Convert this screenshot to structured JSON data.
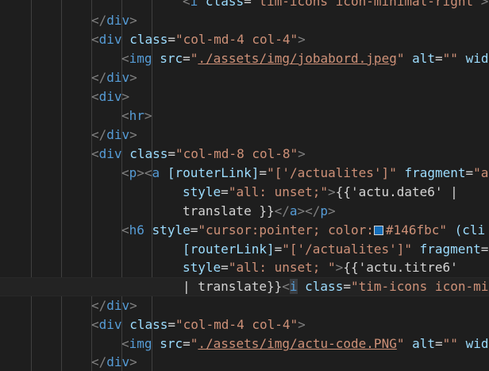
{
  "editor": {
    "swatch_color": "#146fbc",
    "lines": [
      {
        "segments": [
          {
            "cls": "t-p",
            "text": "<"
          },
          {
            "cls": "t-tag",
            "text": "i"
          },
          {
            "cls": "t-txt",
            "text": " "
          },
          {
            "cls": "t-attr",
            "text": "class"
          },
          {
            "cls": "t-txt",
            "text": "="
          },
          {
            "cls": "t-str",
            "text": "\"tim-icons icon-minimal-right\""
          },
          {
            "cls": "t-p",
            "text": ">"
          }
        ]
      },
      {
        "segments": [
          {
            "cls": "t-p",
            "text": "</"
          },
          {
            "cls": "t-tag",
            "text": "div"
          },
          {
            "cls": "t-p",
            "text": ">"
          }
        ]
      },
      {
        "segments": [
          {
            "cls": "t-p",
            "text": "<"
          },
          {
            "cls": "t-tag",
            "text": "div"
          },
          {
            "cls": "t-txt",
            "text": " "
          },
          {
            "cls": "t-attr",
            "text": "class"
          },
          {
            "cls": "t-txt",
            "text": "="
          },
          {
            "cls": "t-str",
            "text": "\"col-md-4 col-4\""
          },
          {
            "cls": "t-p",
            "text": ">"
          }
        ]
      },
      {
        "segments": [
          {
            "cls": "t-p",
            "text": "<"
          },
          {
            "cls": "t-tag",
            "text": "img"
          },
          {
            "cls": "t-txt",
            "text": " "
          },
          {
            "cls": "t-attr",
            "text": "src"
          },
          {
            "cls": "t-txt",
            "text": "="
          },
          {
            "cls": "t-str",
            "text": "\""
          },
          {
            "cls": "t-path",
            "text": "./assets/img/jobabord.jpeg"
          },
          {
            "cls": "t-str",
            "text": "\""
          },
          {
            "cls": "t-txt",
            "text": " "
          },
          {
            "cls": "t-attr",
            "text": "alt"
          },
          {
            "cls": "t-txt",
            "text": "="
          },
          {
            "cls": "t-str",
            "text": "\"\""
          },
          {
            "cls": "t-txt",
            "text": " "
          },
          {
            "cls": "t-attr",
            "text": "wid"
          }
        ]
      },
      {
        "segments": [
          {
            "cls": "t-p",
            "text": "</"
          },
          {
            "cls": "t-tag",
            "text": "div"
          },
          {
            "cls": "t-p",
            "text": ">"
          }
        ]
      },
      {
        "segments": [
          {
            "cls": "t-p",
            "text": "<"
          },
          {
            "cls": "t-tag",
            "text": "div"
          },
          {
            "cls": "t-p",
            "text": ">"
          }
        ]
      },
      {
        "segments": [
          {
            "cls": "t-p",
            "text": "<"
          },
          {
            "cls": "t-tag",
            "text": "hr"
          },
          {
            "cls": "t-p",
            "text": ">"
          }
        ]
      },
      {
        "segments": [
          {
            "cls": "t-p",
            "text": "</"
          },
          {
            "cls": "t-tag",
            "text": "div"
          },
          {
            "cls": "t-p",
            "text": ">"
          }
        ]
      },
      {
        "segments": [
          {
            "cls": "t-p",
            "text": "<"
          },
          {
            "cls": "t-tag",
            "text": "div"
          },
          {
            "cls": "t-txt",
            "text": " "
          },
          {
            "cls": "t-attr",
            "text": "class"
          },
          {
            "cls": "t-txt",
            "text": "="
          },
          {
            "cls": "t-str",
            "text": "\"col-md-8 col-8\""
          },
          {
            "cls": "t-p",
            "text": ">"
          }
        ]
      },
      {
        "segments": [
          {
            "cls": "t-p",
            "text": "<"
          },
          {
            "cls": "t-tag",
            "text": "p"
          },
          {
            "cls": "t-p",
            "text": "><"
          },
          {
            "cls": "t-tag",
            "text": "a"
          },
          {
            "cls": "t-txt",
            "text": " "
          },
          {
            "cls": "t-attr",
            "text": "[routerLink]"
          },
          {
            "cls": "t-txt",
            "text": "="
          },
          {
            "cls": "t-str",
            "text": "\"['/actualites']\""
          },
          {
            "cls": "t-txt",
            "text": " "
          },
          {
            "cls": "t-attr",
            "text": "fragment"
          },
          {
            "cls": "t-txt",
            "text": "="
          },
          {
            "cls": "t-str",
            "text": "\"a"
          }
        ]
      },
      {
        "segments": [
          {
            "cls": "t-attr",
            "text": "style"
          },
          {
            "cls": "t-txt",
            "text": "="
          },
          {
            "cls": "t-str",
            "text": "\"all: unset;\""
          },
          {
            "cls": "t-p",
            "text": ">"
          },
          {
            "cls": "t-txt",
            "text": "{{'actu.date6' |"
          }
        ]
      },
      {
        "segments": [
          {
            "cls": "t-txt",
            "text": "translate }}"
          },
          {
            "cls": "t-p",
            "text": "</"
          },
          {
            "cls": "t-tag",
            "text": "a"
          },
          {
            "cls": "t-p",
            "text": "></"
          },
          {
            "cls": "t-tag",
            "text": "p"
          },
          {
            "cls": "t-p",
            "text": ">"
          }
        ]
      },
      {
        "segments": [
          {
            "cls": "t-p",
            "text": "<"
          },
          {
            "cls": "t-tag",
            "text": "h6"
          },
          {
            "cls": "t-txt",
            "text": " "
          },
          {
            "cls": "t-attr",
            "text": "style"
          },
          {
            "cls": "t-txt",
            "text": "="
          },
          {
            "cls": "t-str",
            "text": "\"cursor:pointer; color:"
          },
          {
            "cls": "swatch",
            "text": ""
          },
          {
            "cls": "t-str",
            "text": "#146fbc\""
          },
          {
            "cls": "t-txt",
            "text": " "
          },
          {
            "cls": "t-attr",
            "text": "(cli"
          }
        ]
      },
      {
        "segments": [
          {
            "cls": "t-attr",
            "text": "[routerLink]"
          },
          {
            "cls": "t-txt",
            "text": "="
          },
          {
            "cls": "t-str",
            "text": "\"['/actualites']\""
          },
          {
            "cls": "t-txt",
            "text": " "
          },
          {
            "cls": "t-attr",
            "text": "fragment"
          },
          {
            "cls": "t-txt",
            "text": "="
          }
        ]
      },
      {
        "segments": [
          {
            "cls": "t-attr",
            "text": "style"
          },
          {
            "cls": "t-txt",
            "text": "="
          },
          {
            "cls": "t-str",
            "text": "\"all: unset; \""
          },
          {
            "cls": "t-p",
            "text": ">"
          },
          {
            "cls": "t-txt",
            "text": "{{'actu.titre6'"
          }
        ]
      },
      {
        "segments": [
          {
            "cls": "t-txt",
            "text": "| translate}}"
          },
          {
            "cls": "t-p",
            "text": "<"
          },
          {
            "cls": "t-tag caret",
            "text": "i"
          },
          {
            "cls": "t-txt",
            "text": " "
          },
          {
            "cls": "t-attr",
            "text": "class"
          },
          {
            "cls": "t-txt",
            "text": "="
          },
          {
            "cls": "t-str",
            "text": "\"tim-icons icon-mi"
          }
        ]
      },
      {
        "segments": [
          {
            "cls": "t-p",
            "text": "</"
          },
          {
            "cls": "t-tag",
            "text": "div"
          },
          {
            "cls": "t-p",
            "text": ">"
          }
        ]
      },
      {
        "segments": [
          {
            "cls": "t-p",
            "text": "<"
          },
          {
            "cls": "t-tag",
            "text": "div"
          },
          {
            "cls": "t-txt",
            "text": " "
          },
          {
            "cls": "t-attr",
            "text": "class"
          },
          {
            "cls": "t-txt",
            "text": "="
          },
          {
            "cls": "t-str",
            "text": "\"col-md-4 col-4\""
          },
          {
            "cls": "t-p",
            "text": ">"
          }
        ]
      },
      {
        "segments": [
          {
            "cls": "t-p",
            "text": "<"
          },
          {
            "cls": "t-tag",
            "text": "img"
          },
          {
            "cls": "t-txt",
            "text": " "
          },
          {
            "cls": "t-attr",
            "text": "src"
          },
          {
            "cls": "t-txt",
            "text": "="
          },
          {
            "cls": "t-str",
            "text": "\""
          },
          {
            "cls": "t-path",
            "text": "./assets/img/actu-code.PNG"
          },
          {
            "cls": "t-str",
            "text": "\""
          },
          {
            "cls": "t-txt",
            "text": " "
          },
          {
            "cls": "t-attr",
            "text": "alt"
          },
          {
            "cls": "t-txt",
            "text": "="
          },
          {
            "cls": "t-str",
            "text": "\"\""
          },
          {
            "cls": "t-txt",
            "text": " "
          },
          {
            "cls": "t-attr",
            "text": "wid"
          }
        ]
      },
      {
        "segments": [
          {
            "cls": "t-p",
            "text": "</"
          },
          {
            "cls": "t-tag",
            "text": "div"
          },
          {
            "cls": "t-p",
            "text": ">"
          }
        ]
      }
    ]
  }
}
